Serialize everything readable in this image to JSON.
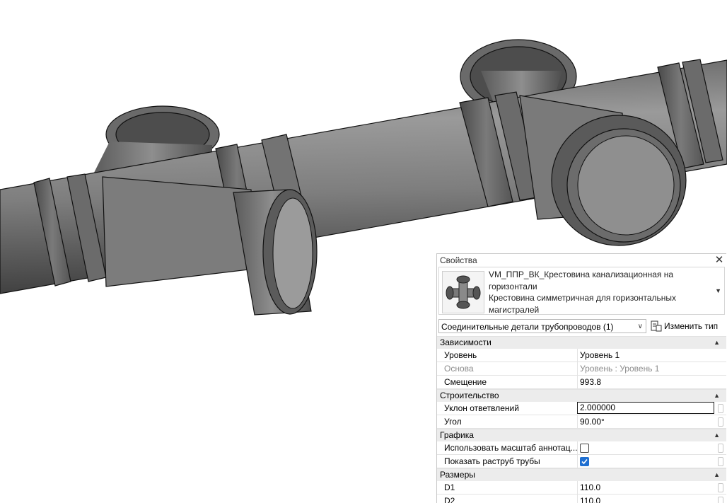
{
  "panel": {
    "title": "Свойства",
    "close_label": "✕",
    "type_lines": [
      "VM_ППР_ВК_Крестовина канализационная на",
      "горизонтали",
      "Крестовина симметричная для горизонтальных",
      "магистралей"
    ],
    "category": "Соединительные детали трубопроводов (1)",
    "edit_type": "Изменить тип",
    "groups": {
      "constraints": {
        "title": "Зависимости",
        "rows": [
          {
            "name": "Уровень",
            "value": "Уровень 1"
          },
          {
            "name": "Основа",
            "value": "Уровень : Уровень 1"
          },
          {
            "name": "Смещение",
            "value": "993.8"
          }
        ]
      },
      "construction": {
        "title": "Строительство",
        "rows": [
          {
            "name": "Уклон ответвлений",
            "value": "2.000000"
          },
          {
            "name": "Угол",
            "value": "90.00°"
          }
        ]
      },
      "graphics": {
        "title": "Графика",
        "rows": [
          {
            "name": "Использовать масштаб аннотац...",
            "checked": false
          },
          {
            "name": "Показать раструб трубы",
            "checked": true
          }
        ]
      },
      "dimensions": {
        "title": "Размеры",
        "rows": [
          {
            "name": "D1",
            "value": "110.0"
          },
          {
            "name": "D2",
            "value": "110.0"
          }
        ]
      }
    }
  },
  "colors": {
    "checkbox_accent": "#1f6fd1",
    "group_header_bg": "#ececec",
    "pipe_shade": "#6f6f6f"
  }
}
